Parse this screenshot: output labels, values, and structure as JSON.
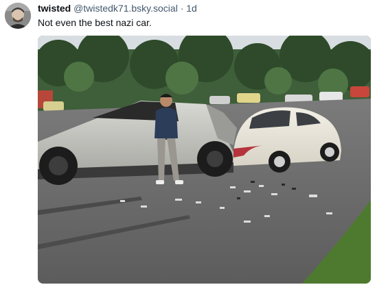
{
  "post": {
    "author": {
      "display_name": "twisted",
      "handle": "@twistedk71.bsky.social",
      "separator": "·",
      "age": "1d",
      "avatar_icon": "user-avatar"
    },
    "text": "Not even the best nazi car.",
    "media": {
      "type": "photo",
      "subject": "cybertruck-vs-beetle-crash"
    }
  },
  "colors": {
    "name_text": "#0b0f14",
    "meta_text": "#42576c",
    "body_text": "#0b0f14",
    "background": "#ffffff"
  }
}
